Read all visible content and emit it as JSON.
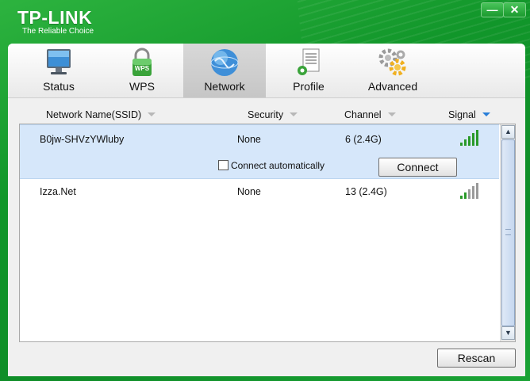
{
  "app": {
    "brand": "TP-LINK",
    "tagline": "The Reliable Choice"
  },
  "window_controls": {
    "minimize": "—",
    "close": "✕"
  },
  "tabs": [
    {
      "label": "Status",
      "icon": "monitor-icon"
    },
    {
      "label": "WPS",
      "icon": "wps-lock-icon",
      "badge": "WPS"
    },
    {
      "label": "Network",
      "icon": "globe-icon",
      "active": true
    },
    {
      "label": "Profile",
      "icon": "profile-document-icon"
    },
    {
      "label": "Advanced",
      "icon": "gears-icon"
    }
  ],
  "columns": {
    "ssid": "Network Name(SSID)",
    "security": "Security",
    "channel": "Channel",
    "signal": "Signal"
  },
  "networks": [
    {
      "ssid": "B0jw-SHVzYWluby",
      "security": "None",
      "channel": "6 (2.4G)",
      "signal_bars": 5,
      "selected": true
    },
    {
      "ssid": "Izza.Net",
      "security": "None",
      "channel": "13 (2.4G)",
      "signal_bars": 2,
      "selected": false
    }
  ],
  "selected_row": {
    "auto_connect_label": "Connect automatically",
    "auto_connect_checked": false,
    "connect_label": "Connect"
  },
  "rescan_label": "Rescan",
  "colors": {
    "frame_green": "#11962a",
    "signal_green": "#2a9a2a",
    "signal_gray": "#9a9a9a",
    "selected_row": "#d6e7fa"
  }
}
